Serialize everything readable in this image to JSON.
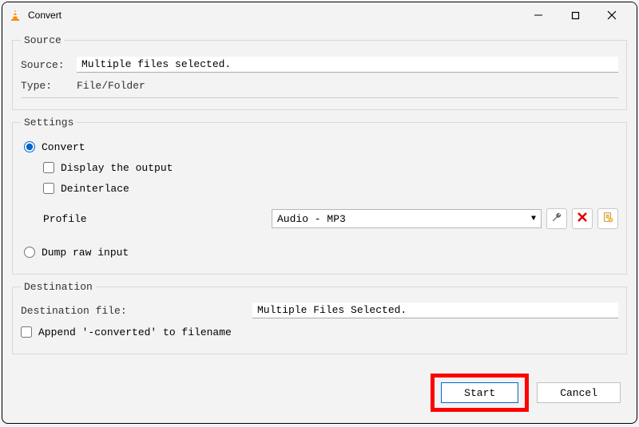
{
  "window": {
    "title": "Convert"
  },
  "source": {
    "legend": "Source",
    "source_label": "Source:",
    "source_value": "Multiple files selected.",
    "type_label": "Type:",
    "type_value": "File/Folder"
  },
  "settings": {
    "legend": "Settings",
    "convert_label": "Convert",
    "display_output_label": "Display the output",
    "deinterlace_label": "Deinterlace",
    "profile_label": "Profile",
    "profile_value": "Audio - MP3",
    "dump_raw_label": "Dump raw input"
  },
  "destination": {
    "legend": "Destination",
    "file_label": "Destination file:",
    "file_value": "Multiple Files Selected.",
    "append_label": "Append '-converted' to filename"
  },
  "footer": {
    "start_label": "Start",
    "cancel_label": "Cancel"
  }
}
